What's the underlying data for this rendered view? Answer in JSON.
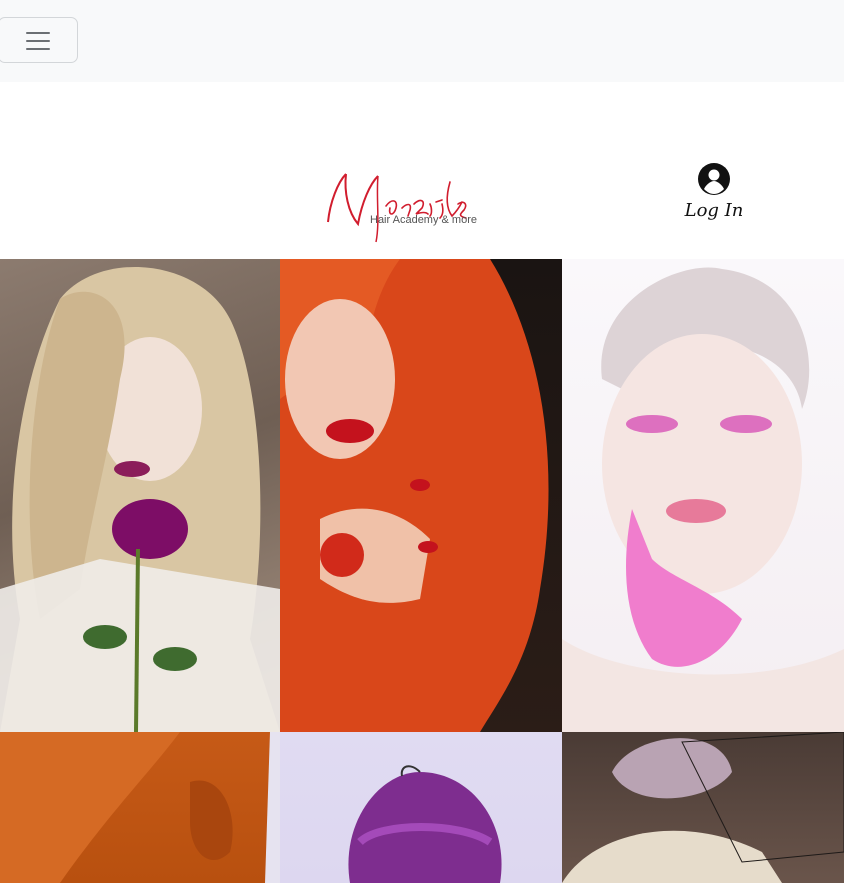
{
  "navbar": {
    "toggle_icon": "hamburger-icon"
  },
  "header": {
    "logo": {
      "script_text": "Nazmie",
      "tagline": "Hair Academy & more"
    },
    "login": {
      "icon": "user-circle-icon",
      "label": "Log In"
    }
  },
  "gallery": {
    "images": [
      {
        "subject": "blonde-curls-rose"
      },
      {
        "subject": "copper-hair-red-nails"
      },
      {
        "subject": "platinum-pink-makeup"
      },
      {
        "subject": "copper-braid"
      },
      {
        "subject": "purple-floral-cap"
      },
      {
        "subject": "glitter-bow-veil"
      }
    ]
  },
  "colors": {
    "navbar_bg": "#f8f9fa",
    "logo_red": "#d11d2e",
    "text_dark": "#111111"
  }
}
